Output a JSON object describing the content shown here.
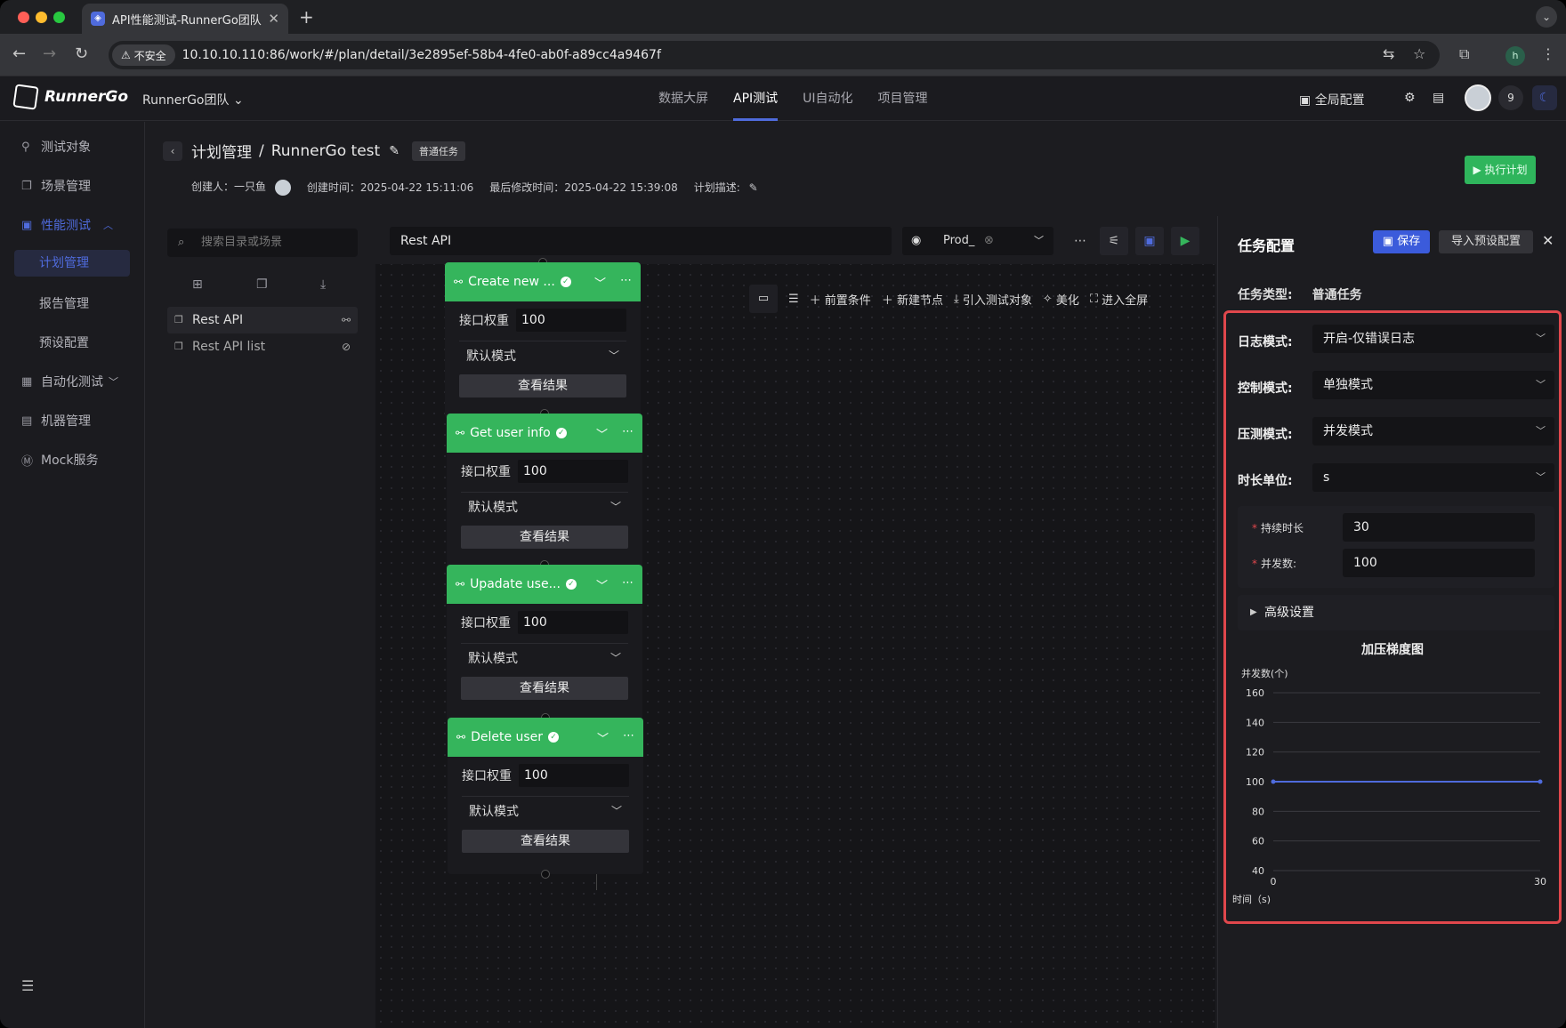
{
  "browser": {
    "tab_title": "API性能测试-RunnerGo团队",
    "insecure_label": "不安全",
    "url": "10.10.10.110:86/work/#/plan/detail/3e2895ef-58b4-4fe0-ab0f-a89cc4a9467f",
    "profile_initial": "h"
  },
  "app": {
    "logo_text": "RunnerGo",
    "team": "RunnerGo团队",
    "nav": [
      "数据大屏",
      "API测试",
      "UI自动化",
      "项目管理"
    ],
    "active_nav": "API测试",
    "global_config": "全局配置",
    "notification_count": "9"
  },
  "sidebar": {
    "items": [
      {
        "label": "测试对象",
        "icon": "link-icon"
      },
      {
        "label": "场景管理",
        "icon": "copy-icon"
      },
      {
        "label": "性能测试",
        "icon": "clipboard-icon"
      },
      {
        "label": "计划管理"
      },
      {
        "label": "报告管理"
      },
      {
        "label": "预设配置"
      },
      {
        "label": "自动化测试",
        "icon": "robot-icon"
      },
      {
        "label": "机器管理",
        "icon": "server-icon"
      },
      {
        "label": "Mock服务",
        "icon": "mock-icon"
      }
    ]
  },
  "page": {
    "breadcrumb_root": "计划管理",
    "separator": "/",
    "plan_name": "RunnerGo test",
    "task_badge": "普通任务",
    "creator_label": "创建人：一只鱼",
    "created_label": "创建时间：2025-04-22 15:11:06",
    "modified_label": "最后修改时间：2025-04-22 15:39:08",
    "desc_label": "计划描述:",
    "run_button": "执行计划"
  },
  "tree": {
    "search_placeholder": "搜索目录或场景",
    "items": [
      {
        "label": "Rest API"
      },
      {
        "label": "Rest API list"
      }
    ]
  },
  "canvas": {
    "scene_name": "Rest API",
    "env": "Prod_",
    "toolbar": [
      "前置条件",
      "新建节点",
      "引入测试对象",
      "美化",
      "进入全屏"
    ],
    "nodes": [
      {
        "title": "Create new ...",
        "weight_label": "接口权重",
        "weight": "100",
        "mode": "默认模式",
        "result": "查看结果"
      },
      {
        "title": "Get user info",
        "weight_label": "接口权重",
        "weight": "100",
        "mode": "默认模式",
        "result": "查看结果"
      },
      {
        "title": "Upadate use...",
        "weight_label": "接口权重",
        "weight": "100",
        "mode": "默认模式",
        "result": "查看结果"
      },
      {
        "title": "Delete user",
        "weight_label": "接口权重",
        "weight": "100",
        "mode": "默认模式",
        "result": "查看结果"
      }
    ]
  },
  "config": {
    "title": "任务配置",
    "save": "保存",
    "import": "导入预设配置",
    "task_type_label": "任务类型:",
    "task_type_value": "普通任务",
    "log_mode_label": "日志模式:",
    "log_mode_value": "开启-仅错误日志",
    "control_mode_label": "控制模式:",
    "control_mode_value": "单独模式",
    "pressure_mode_label": "压测模式:",
    "pressure_mode_value": "并发模式",
    "time_unit_label": "时长单位:",
    "time_unit_value": "s",
    "duration_label": "持续时长",
    "duration_value": "30",
    "concurrency_label": "并发数:",
    "concurrency_value": "100",
    "advanced": "高级设置",
    "chart_title": "加压梯度图"
  },
  "chart_data": {
    "type": "line",
    "title": "加压梯度图",
    "ylabel": "并发数(个)",
    "xlabel": "时间（s)",
    "x": [
      0,
      30
    ],
    "series": [
      {
        "values": [
          100,
          100
        ]
      }
    ],
    "ylim": [
      40,
      160
    ],
    "yticks": [
      40,
      60,
      80,
      100,
      120,
      140,
      160
    ],
    "xticks": [
      0,
      30
    ],
    "grid": true,
    "line_color": "#4f6bdc"
  },
  "colors": {
    "accent": "#4f6bdc",
    "success": "#35b55c",
    "highlight": "#e0474c"
  }
}
